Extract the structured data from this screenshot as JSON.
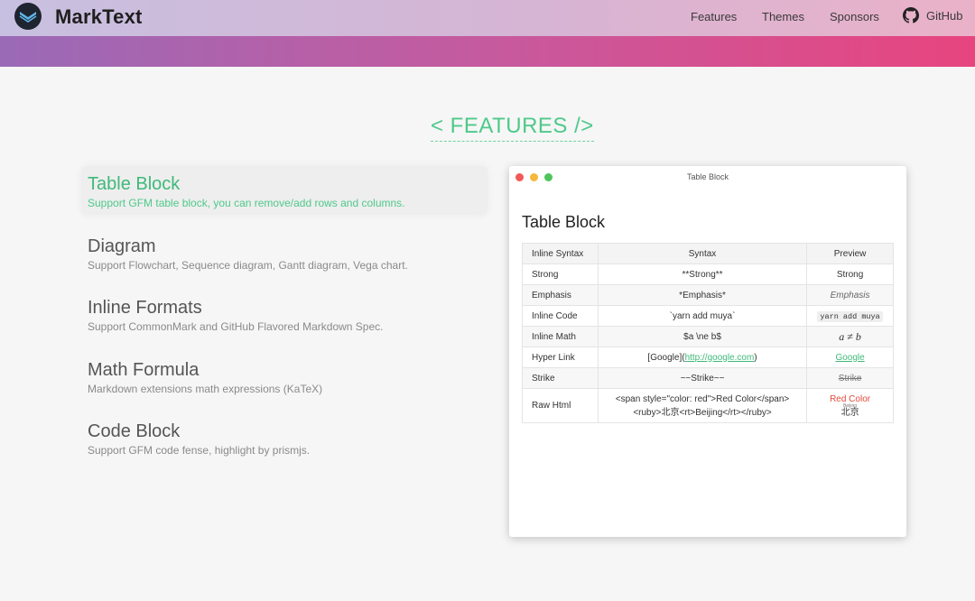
{
  "header": {
    "brand": "MarkText",
    "nav": {
      "features": "Features",
      "themes": "Themes",
      "sponsors": "Sponsors",
      "github": "GitHub"
    }
  },
  "section_title": "< FEATURES />",
  "features": [
    {
      "title": "Table Block",
      "desc": "Support GFM table block, you can remove/add rows and columns."
    },
    {
      "title": "Diagram",
      "desc": "Support Flowchart, Sequence diagram, Gantt diagram, Vega chart."
    },
    {
      "title": "Inline Formats",
      "desc": "Support CommonMark and GitHub Flavored Markdown Spec."
    },
    {
      "title": "Math Formula",
      "desc": "Markdown extensions math expressions (KaTeX)"
    },
    {
      "title": "Code Block",
      "desc": "Support GFM code fense, highlight by prismjs."
    }
  ],
  "window": {
    "title": "Table Block",
    "heading": "Table Block",
    "table": {
      "headers": [
        "Inline Syntax",
        "Syntax",
        "Preview"
      ],
      "rows": [
        {
          "name": "Strong",
          "syntax": "**Strong**",
          "preview": "Strong"
        },
        {
          "name": "Emphasis",
          "syntax": "*Emphasis*",
          "preview": "Emphasis"
        },
        {
          "name": "Inline Code",
          "syntax": "`yarn add muya`",
          "preview": "yarn add muya"
        },
        {
          "name": "Inline Math",
          "syntax": "$a \\ne b$",
          "preview": "a ≠ b"
        },
        {
          "name": "Hyper Link",
          "syntax_pre": "[Google](",
          "syntax_link": "http://google.com",
          "syntax_post": ")",
          "preview": "Google"
        },
        {
          "name": "Strike",
          "syntax": "~~Strike~~",
          "preview": "Strike"
        },
        {
          "name": "Raw Html",
          "syntax_line1": "<span style=\"color: red\">Red Color</span>",
          "syntax_line2": "<ruby>北京<rt>Beijing</rt></ruby>",
          "preview_red": "Red Color",
          "preview_ruby_rt": "Beijing",
          "preview_ruby_base": "北京"
        }
      ]
    }
  },
  "colors": {
    "accent": "#3fb97a",
    "band_start": "#9a6ab7",
    "band_end": "#e7457f"
  }
}
